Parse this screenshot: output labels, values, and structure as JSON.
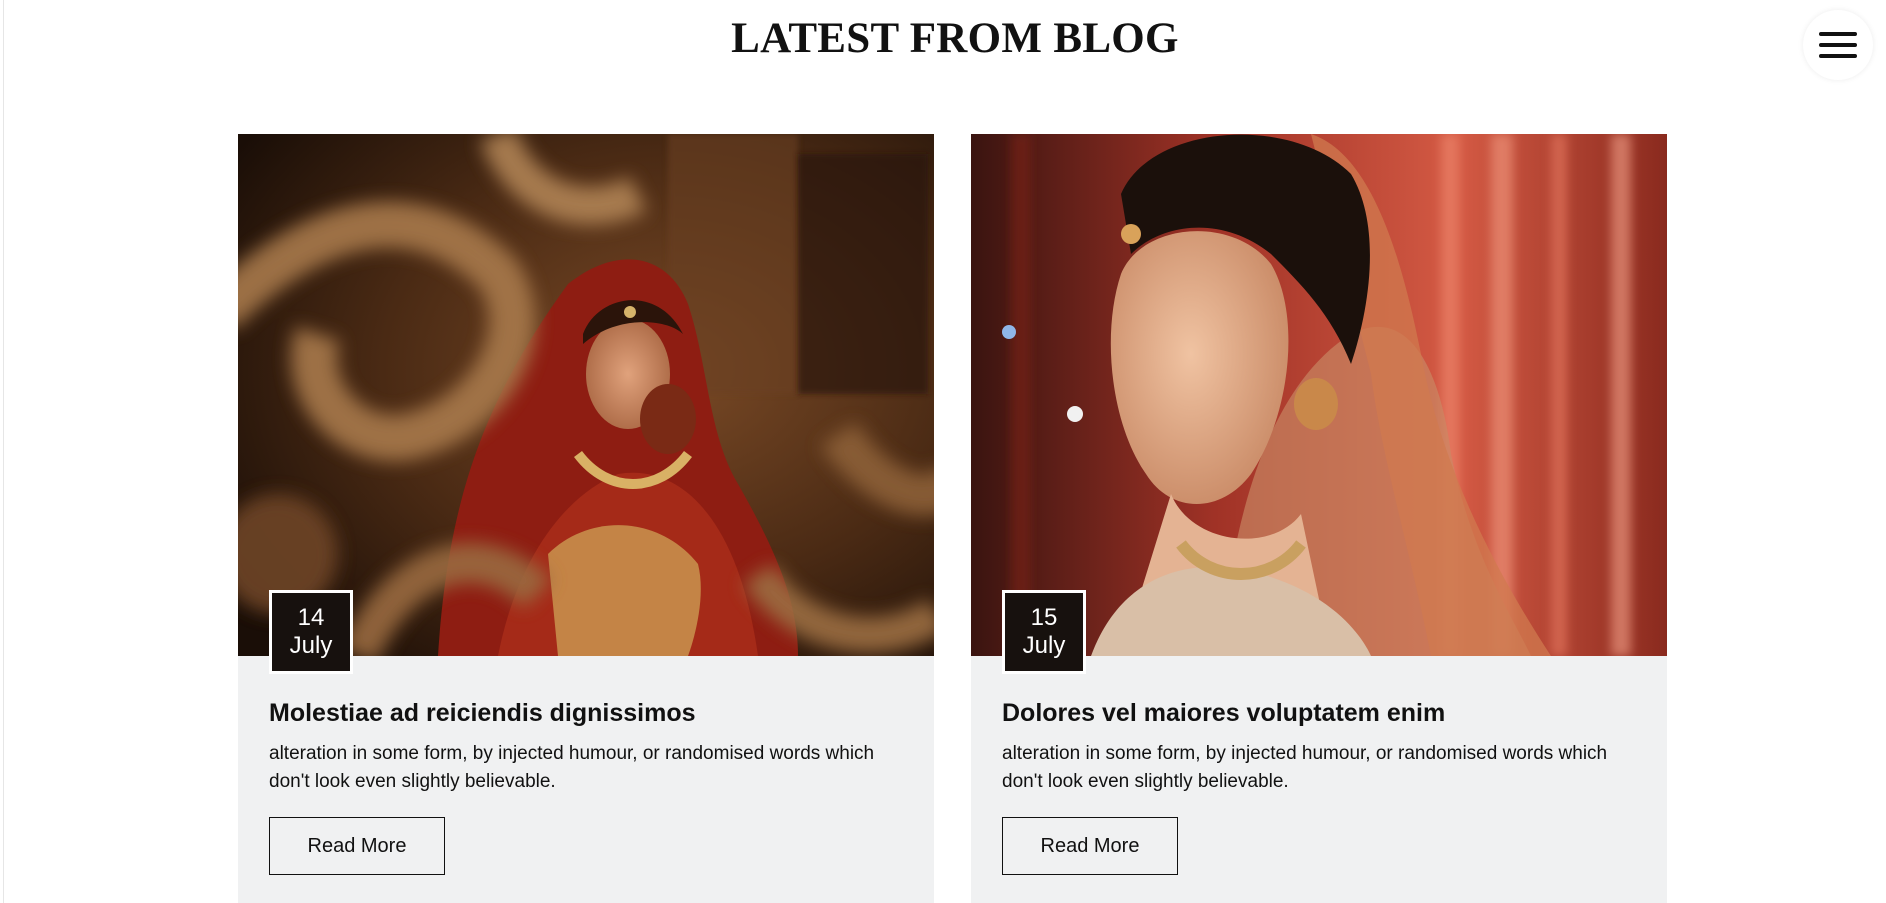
{
  "section": {
    "title": "LATEST FROM BLOG"
  },
  "menu": {
    "icon": "hamburger-menu-icon"
  },
  "posts": [
    {
      "day": "14",
      "month": "July",
      "title": "Molestiae ad reiciendis dignissimos",
      "excerpt": "alteration in some form, by injected humour, or randomised words which don't look even slightly believable.",
      "button_label": "Read More"
    },
    {
      "day": "15",
      "month": "July",
      "title": "Dolores vel maiores voluptatem enim",
      "excerpt": "alteration in some form, by injected humour, or randomised words which don't look even slightly believable.",
      "button_label": "Read More"
    }
  ],
  "colors": {
    "card_bg": "#f0f1f2",
    "badge_bg": "#17110e",
    "text": "#111111"
  }
}
